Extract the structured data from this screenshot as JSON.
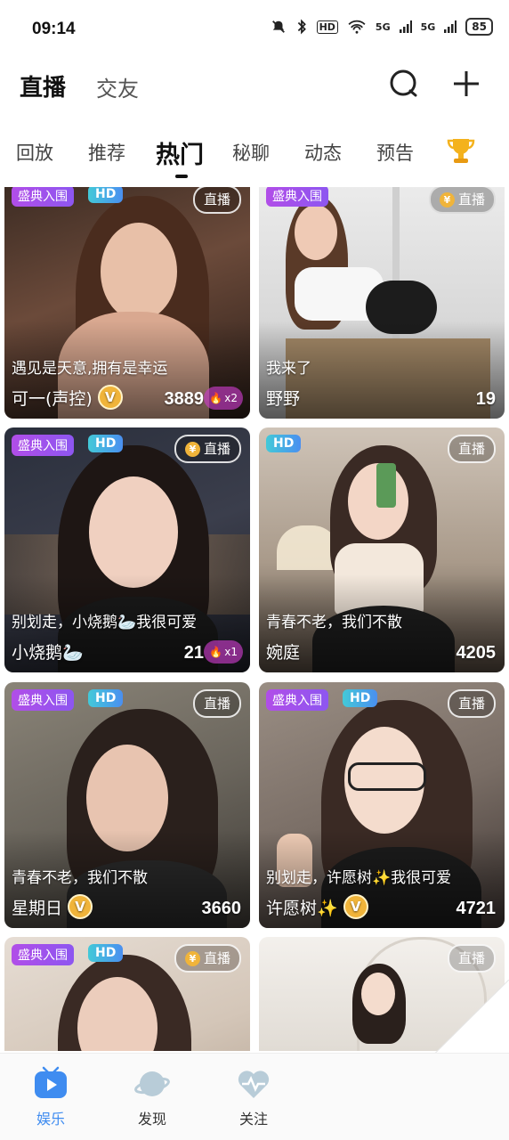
{
  "status_bar": {
    "time": "09:14",
    "net_label": "HD",
    "sig1": "5G",
    "sig2": "5G",
    "battery": "85"
  },
  "header": {
    "tabs": [
      {
        "label": "直播",
        "active": true
      },
      {
        "label": "交友",
        "active": false
      }
    ],
    "icons": [
      "search-icon",
      "plus-icon"
    ]
  },
  "subtabs": [
    {
      "label": "回放"
    },
    {
      "label": "推荐"
    },
    {
      "label": "热门",
      "active": true
    },
    {
      "label": "秘聊"
    },
    {
      "label": "动态"
    },
    {
      "label": "预告"
    }
  ],
  "labels": {
    "ceremony": "盛典入围",
    "hd": "HD",
    "live": "直播",
    "v": "V"
  },
  "cards": [
    {
      "desc": "遇见是天意,拥有是幸运",
      "name": "可一(声控)",
      "count": "3889",
      "flame": "x2",
      "ceremony": true,
      "hd": true,
      "live_coin": false
    },
    {
      "desc": "我来了",
      "name": "野野",
      "count": "19",
      "ceremony": true,
      "hd": false,
      "live_coin": true
    },
    {
      "desc": "别划走，小烧鹅🦢我很可爱",
      "name": "小烧鹅🦢",
      "count": "21",
      "flame": "x1",
      "ceremony": true,
      "hd": true,
      "live_coin": true
    },
    {
      "desc": "青春不老，我们不散",
      "name": "婉庭",
      "count": "4205",
      "ceremony": false,
      "hd": true,
      "live_coin": false
    },
    {
      "desc": "青春不老，我们不散",
      "name": "星期日",
      "count": "3660",
      "ceremony": true,
      "hd": true,
      "live_coin": false
    },
    {
      "desc": "别划走，许愿树✨我很可爱",
      "name": "许愿树✨",
      "count": "4721",
      "ceremony": true,
      "hd": true,
      "live_coin": false
    },
    {
      "desc": "",
      "name": "",
      "count": "",
      "ceremony": true,
      "hd": true,
      "live_coin": true
    },
    {
      "desc": "",
      "name": "",
      "count": "",
      "ceremony": false,
      "hd": false,
      "live_coin": false
    }
  ],
  "bottom_nav": [
    {
      "label": "娱乐",
      "icon": "tv-icon",
      "active": true
    },
    {
      "label": "发现",
      "icon": "planet-icon",
      "active": false
    },
    {
      "label": "关注",
      "icon": "heart-pulse-icon",
      "active": false
    }
  ],
  "colors": {
    "accent": "#3f8cf0",
    "ceremony_badge": "#a24fec",
    "hd_badge": "#43b8e0",
    "coin": "#f0b43a"
  }
}
